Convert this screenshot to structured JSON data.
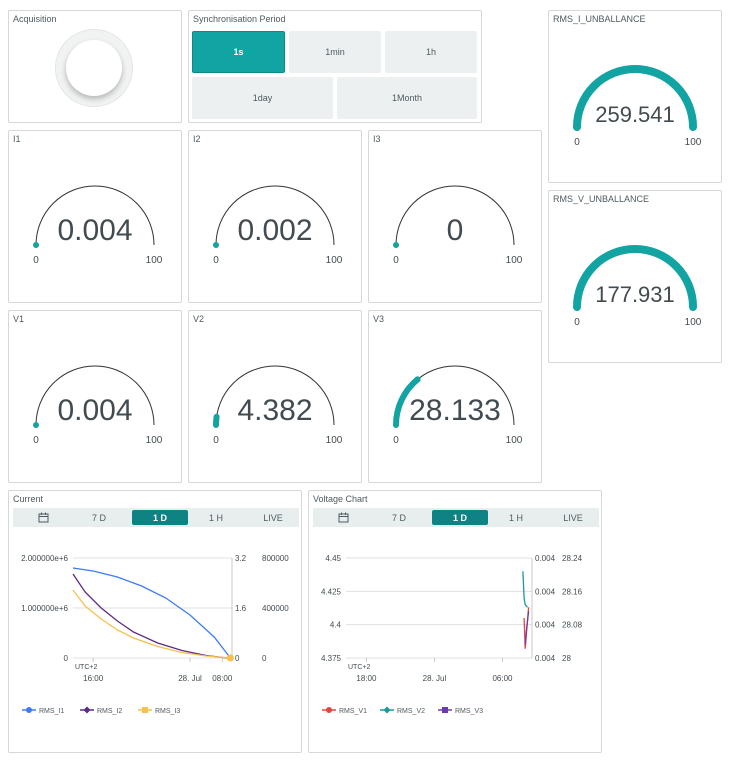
{
  "acquisition": {
    "title": "Acquisition"
  },
  "sync": {
    "title": "Synchronisation Period",
    "options": [
      "1s",
      "1min",
      "1h",
      "1day",
      "1Month"
    ],
    "active": "1s"
  },
  "gauges": {
    "rms_i": {
      "title": "RMS_I_UNBALLANCE",
      "value": "259.541",
      "min": "0",
      "max": "100",
      "level": 1.0
    },
    "rms_v": {
      "title": "RMS_V_UNBALLANCE",
      "value": "177.931",
      "min": "0",
      "max": "100",
      "level": 1.0
    },
    "i1": {
      "title": "I1",
      "value": "0.004",
      "min": "0",
      "max": "100",
      "level": 0.0
    },
    "i2": {
      "title": "I2",
      "value": "0.002",
      "min": "0",
      "max": "100",
      "level": 0.0
    },
    "i3": {
      "title": "I3",
      "value": "0",
      "min": "0",
      "max": "100",
      "level": 0.0
    },
    "v1": {
      "title": "V1",
      "value": "0.004",
      "min": "0",
      "max": "100",
      "level": 0.0
    },
    "v2": {
      "title": "V2",
      "value": "4.382",
      "min": "0",
      "max": "100",
      "level": 0.044
    },
    "v3": {
      "title": "V3",
      "value": "28.133",
      "min": "0",
      "max": "100",
      "level": 0.281
    }
  },
  "colors": {
    "accent": "#12a3a3",
    "tab_active": "#0f8383",
    "gauge_track": "#333333",
    "rms_i1": "#3d7bf2",
    "rms_i2": "#5b2c86",
    "rms_i3": "#f7c04a",
    "rms_v1": "#e2463d",
    "rms_v2": "#1a9a9a",
    "rms_v3": "#6a3ab0"
  },
  "current_chart": {
    "title": "Current",
    "tabs": [
      "7 D",
      "1 D",
      "1 H",
      "LIVE"
    ],
    "active_tab": "1 D",
    "calendar_icon": "calendar-icon"
  },
  "voltage_chart": {
    "title": "Voltage Chart",
    "tabs": [
      "7 D",
      "1 D",
      "1 H",
      "LIVE"
    ],
    "active_tab": "1 D",
    "calendar_icon": "calendar-icon"
  },
  "chart_data": [
    {
      "type": "line",
      "title": "Current",
      "timezone_label": "UTC+2",
      "x_tick_labels": [
        "16:00",
        "28. Jul",
        "08:00"
      ],
      "x_ticks_hours": [
        16,
        28,
        32
      ],
      "x_range_hours": [
        13.5,
        33.2
      ],
      "y_axes": [
        {
          "ticks": [
            "0",
            "1.000000e+6",
            "2.000000e+6"
          ],
          "range": [
            0,
            2000000
          ]
        },
        {
          "ticks": [
            "0",
            "1.6",
            "3.2"
          ],
          "range": [
            0,
            3.2
          ]
        },
        {
          "ticks": [
            "0",
            "400000",
            "800000"
          ],
          "range": [
            0,
            800000
          ]
        }
      ],
      "series": [
        {
          "name": "RMS_I1",
          "axis": 0,
          "points": [
            [
              13.5,
              1800000
            ],
            [
              16,
              1740000
            ],
            [
              19,
              1620000
            ],
            [
              22,
              1440000
            ],
            [
              25,
              1200000
            ],
            [
              28,
              860000
            ],
            [
              31,
              420000
            ],
            [
              33,
              0
            ]
          ]
        },
        {
          "name": "RMS_I2",
          "axis": 0,
          "points": [
            [
              13.5,
              1680000
            ],
            [
              15,
              1320000
            ],
            [
              17,
              1000000
            ],
            [
              19,
              740000
            ],
            [
              21,
              520000
            ],
            [
              24,
              300000
            ],
            [
              27,
              150000
            ],
            [
              30,
              50000
            ],
            [
              32.6,
              0
            ]
          ]
        },
        {
          "name": "RMS_I3",
          "axis": 0,
          "points": [
            [
              13.5,
              1360000
            ],
            [
              15,
              1040000
            ],
            [
              17,
              780000
            ],
            [
              19,
              560000
            ],
            [
              21,
              400000
            ],
            [
              24,
              230000
            ],
            [
              27,
              110000
            ],
            [
              30,
              40000
            ],
            [
              33,
              0
            ]
          ]
        }
      ],
      "legend_position": "bottom-left"
    },
    {
      "type": "line",
      "title": "Voltage Chart",
      "timezone_label": "UTC+2",
      "x_tick_labels": [
        "18:00",
        "28. Jul",
        "06:00"
      ],
      "x_ticks_hours": [
        18,
        24,
        30
      ],
      "x_range_hours": [
        16.2,
        32.6
      ],
      "y_axes": [
        {
          "ticks": [
            "4.375",
            "4.4",
            "4.425",
            "4.45"
          ],
          "range": [
            4.375,
            4.45
          ]
        },
        {
          "ticks": [
            "0.004",
            "0.004",
            "0.004",
            "0.004"
          ],
          "range": [
            0.0035,
            0.0045
          ]
        },
        {
          "ticks": [
            "28",
            "28.08",
            "28.16",
            "28.24"
          ],
          "range": [
            28,
            28.24
          ]
        }
      ],
      "series": [
        {
          "name": "RMS_V1",
          "axis": 0,
          "points": [
            [
              31.9,
              4.405
            ],
            [
              32.0,
              4.382
            ],
            [
              32.1,
              4.392
            ],
            [
              32.3,
              4.413
            ]
          ]
        },
        {
          "name": "RMS_V2",
          "axis": 0,
          "points": [
            [
              31.8,
              4.44
            ],
            [
              31.9,
              4.42
            ],
            [
              32.0,
              4.415
            ],
            [
              32.2,
              4.413
            ]
          ]
        },
        {
          "name": "RMS_V3",
          "axis": 0,
          "points": [
            [
              32.0,
              4.385
            ],
            [
              32.1,
              4.395
            ],
            [
              32.3,
              4.41
            ]
          ]
        }
      ],
      "legend_position": "bottom-left"
    }
  ]
}
